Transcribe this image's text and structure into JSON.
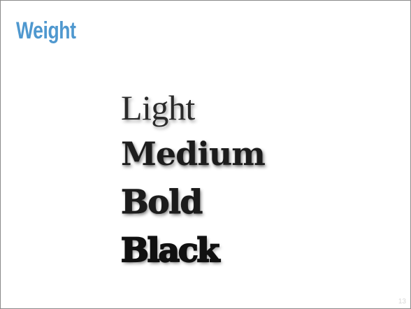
{
  "slide": {
    "title": "Weight",
    "title_color": "#4f98cf",
    "weights": [
      {
        "label": "Light"
      },
      {
        "label": "Medium"
      },
      {
        "label": "Bold"
      },
      {
        "label": "Black"
      }
    ],
    "page_number": "13"
  }
}
